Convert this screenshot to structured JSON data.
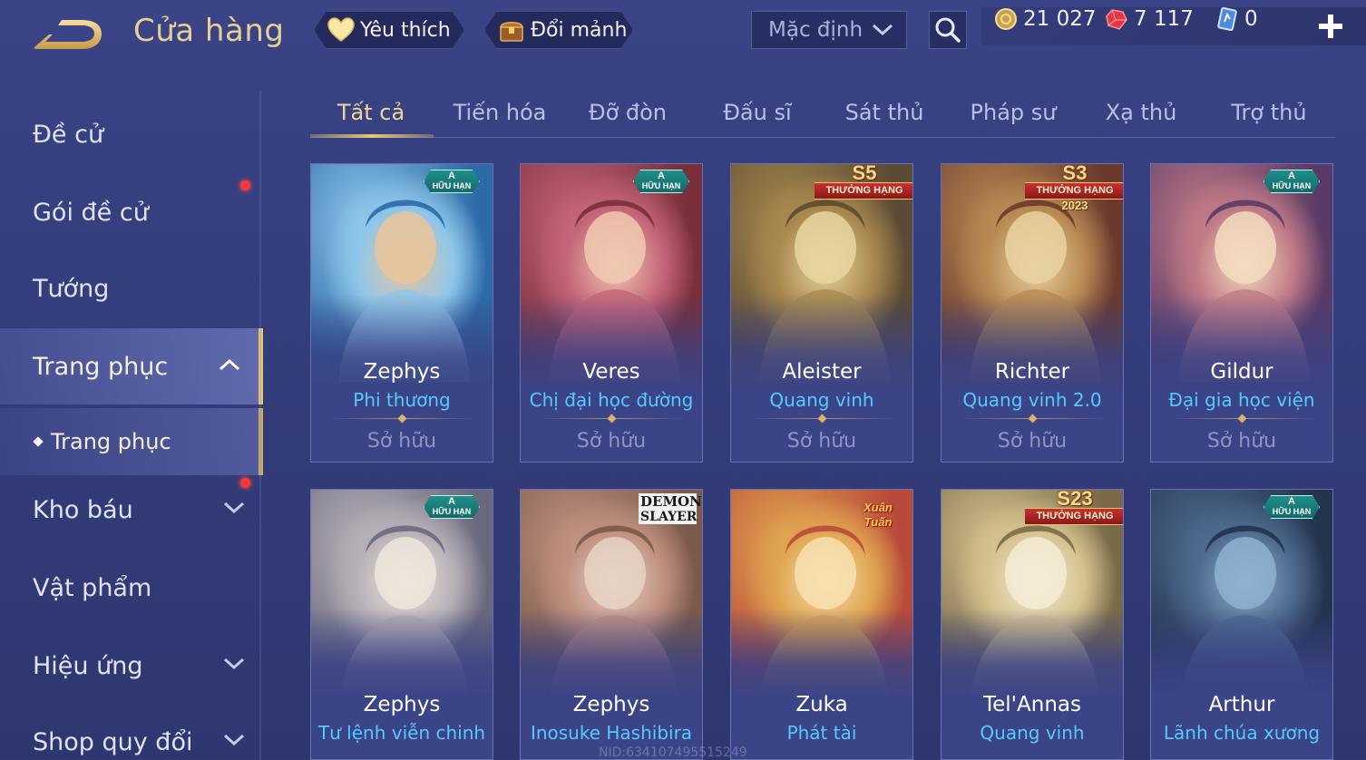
{
  "header": {
    "title": "Cửa hàng",
    "favorite_label": "Yêu thích",
    "exchange_label": "Đổi mảnh",
    "sort_selected": "Mặc định"
  },
  "currency": {
    "gold": "21 027",
    "ruby": "7 117",
    "voucher": "0"
  },
  "sidebar": {
    "items": [
      {
        "label": "Đề cử"
      },
      {
        "label": "Gói đề cử"
      },
      {
        "label": "Tướng"
      },
      {
        "label": "Trang phục"
      },
      {
        "label": "Kho báu"
      },
      {
        "label": "Vật phẩm"
      },
      {
        "label": "Hiệu ứng"
      },
      {
        "label": "Shop quy đổi"
      }
    ],
    "sub_items": [
      {
        "label": "Trang phục"
      }
    ]
  },
  "tabs": [
    {
      "label": "Tất cả"
    },
    {
      "label": "Tiến hóa"
    },
    {
      "label": "Đỡ đòn"
    },
    {
      "label": "Đấu sĩ"
    },
    {
      "label": "Sát thủ"
    },
    {
      "label": "Pháp sư"
    },
    {
      "label": "Xạ thủ"
    },
    {
      "label": "Trợ thủ"
    }
  ],
  "cards": [
    {
      "hero": "Zephys",
      "skin": "Phi thương",
      "status": "Sở hữu",
      "badge_top": "A",
      "badge_bottom": "HỮU HẠN"
    },
    {
      "hero": "Veres",
      "skin": "Chị đại học đường",
      "status": "Sở hữu",
      "badge_top": "A",
      "badge_bottom": "HỮU HẠN"
    },
    {
      "hero": "Aleister",
      "skin": "Quang vinh",
      "status": "Sở hữu",
      "badge_top": "S5",
      "badge_bottom": "THƯỞNG HẠNG"
    },
    {
      "hero": "Richter",
      "skin": "Quang vinh 2.0",
      "status": "Sở hữu",
      "badge_top": "S3",
      "badge_bottom": "THƯỞNG HẠNG",
      "badge_year": "2023"
    },
    {
      "hero": "Gildur",
      "skin": "Đại gia học viện",
      "status": "Sở hữu",
      "badge_top": "A",
      "badge_bottom": "HỮU HẠN"
    },
    {
      "hero": "Zephys",
      "skin": "Tư lệnh viễn chinh",
      "badge_top": "A",
      "badge_bottom": "HỮU HẠN"
    },
    {
      "hero": "Zephys",
      "skin": "Inosuke Hashibira",
      "badge_top": "DEMON",
      "badge_bottom": "SLAYER"
    },
    {
      "hero": "Zuka",
      "skin": "Phát tài",
      "badge_top": "Xuân Tuấn"
    },
    {
      "hero": "Tel'Annas",
      "skin": "Quang vinh",
      "badge_top": "S23",
      "badge_bottom": "THƯỞNG HẠNG"
    },
    {
      "hero": "Arthur",
      "skin": "Lãnh chúa xương",
      "badge_top": "A",
      "badge_bottom": "HỮU HẠN"
    }
  ],
  "watermark": "NID:634107495515249",
  "colors": {
    "background": "#363f7e",
    "title_gold": "#e6cf92",
    "active_tab": "#f1d79a",
    "skin_name_blue": "#57c9ff",
    "status_gray": "#8e95c1",
    "notification_red": "#ff3636"
  },
  "icons": {
    "back": "back-arrow-icon",
    "favorite": "heart-icon",
    "exchange": "treasure-chest-icon",
    "sort": "chevron-down-icon",
    "search": "search-icon",
    "gold": "gold-coin-icon",
    "ruby": "ruby-icon",
    "voucher": "voucher-icon",
    "add": "plus-icon"
  }
}
